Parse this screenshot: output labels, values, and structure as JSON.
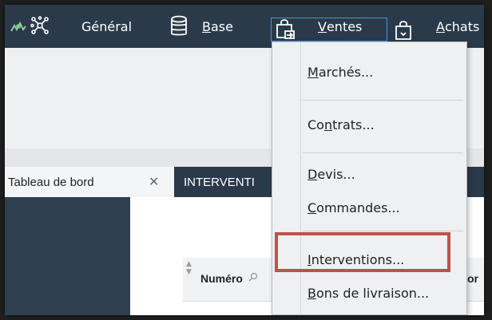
{
  "menubar": {
    "items": [
      {
        "label": "Général",
        "underline": ""
      },
      {
        "label": "ase",
        "prefix": "B"
      },
      {
        "label": "entes",
        "prefix": "V"
      },
      {
        "label": "chats",
        "prefix": "A"
      }
    ]
  },
  "tabs": {
    "active_label": "Tableau de bord",
    "close_symbol": "✕",
    "inactive_label": "INTERVENTI"
  },
  "grid": {
    "column_numero": "Numéro"
  },
  "dropdown": {
    "items": [
      {
        "u": "M",
        "rest": "archés..."
      },
      {
        "pre": "Co",
        "u": "n",
        "rest": "trats..."
      },
      {
        "u": "D",
        "rest": "evis..."
      },
      {
        "u": "C",
        "rest": "ommandes..."
      },
      {
        "u": "I",
        "rest": "nterventions..."
      },
      {
        "u": "B",
        "rest": "ons de livraison..."
      }
    ],
    "partial_right": "or"
  },
  "colors": {
    "menubar": "#2b3a4a",
    "highlight": "#c0504d",
    "active_menu_border": "#4a8fd8"
  }
}
